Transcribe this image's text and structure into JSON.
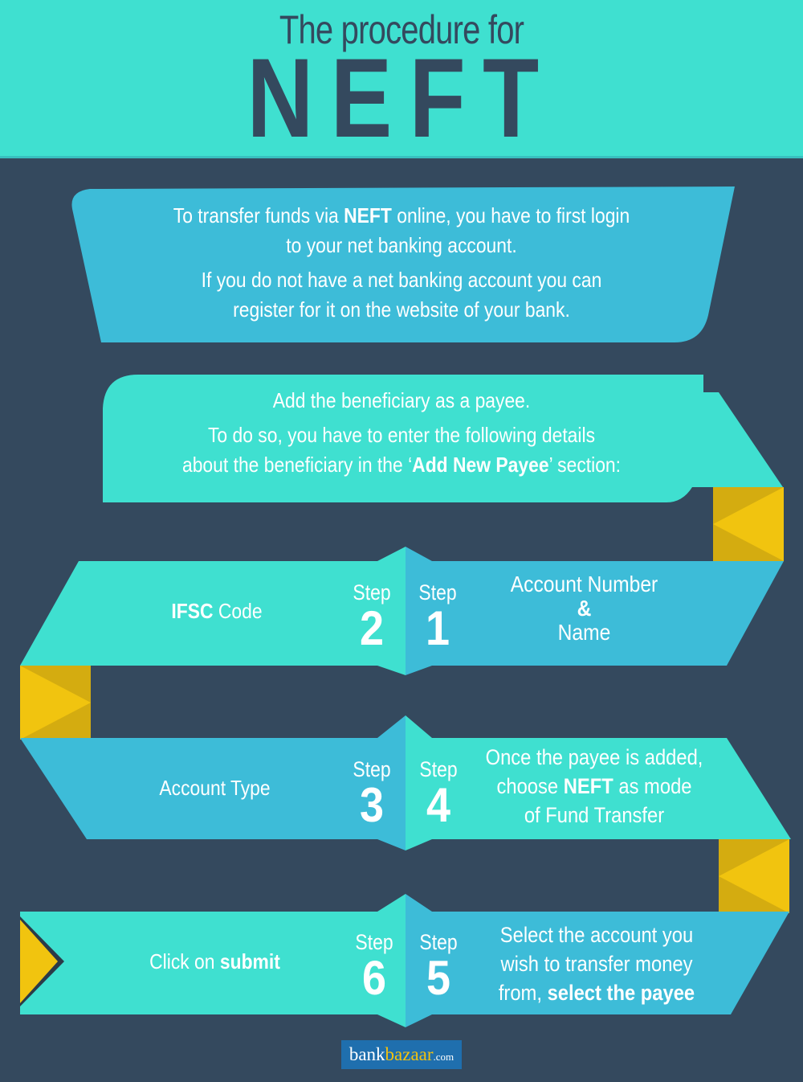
{
  "header": {
    "title_line": "The procedure for",
    "title_main": "NEFT"
  },
  "intro": {
    "line1_pre": "To transfer funds via ",
    "line1_bold": "NEFT",
    "line1_post": " online, you have to first login",
    "line2": "to your net banking account.",
    "line3": "If you do not have a net banking account you can",
    "line4": "register for it on the website of your bank."
  },
  "payee": {
    "line1": "Add the beneficiary as a payee.",
    "line2": "To do so, you have to enter the following details",
    "line3_pre": "about the beneficiary in the ‘",
    "line3_bold": "Add New Payee",
    "line3_post": "’ section:"
  },
  "steps": {
    "word": "Step",
    "s1": {
      "num": "1",
      "line1": "Account Number",
      "line2": "&",
      "line3": "Name"
    },
    "s2": {
      "num": "2",
      "bold": "IFSC",
      "text": " Code"
    },
    "s3": {
      "num": "3",
      "text": "Account Type"
    },
    "s4": {
      "num": "4",
      "line1": "Once the payee is added,",
      "line2_pre": "choose ",
      "line2_bold": "NEFT",
      "line2_post": " as mode",
      "line3": "of Fund Transfer"
    },
    "s5": {
      "num": "5",
      "line1": "Select the account you",
      "line2": "wish to transfer money",
      "line3_pre": "from, ",
      "line3_bold": "select the payee"
    },
    "s6": {
      "num": "6",
      "pre": "Click on ",
      "bold": "submit"
    }
  },
  "logo": {
    "part1": "bank",
    "part2": "bazaar",
    "part3": ".com"
  },
  "colors": {
    "background": "#34495e",
    "teal": "#3fe0d0",
    "blue": "#3dbcd8",
    "gold": "#f1c40f",
    "gold_dark": "#d4ac10"
  }
}
